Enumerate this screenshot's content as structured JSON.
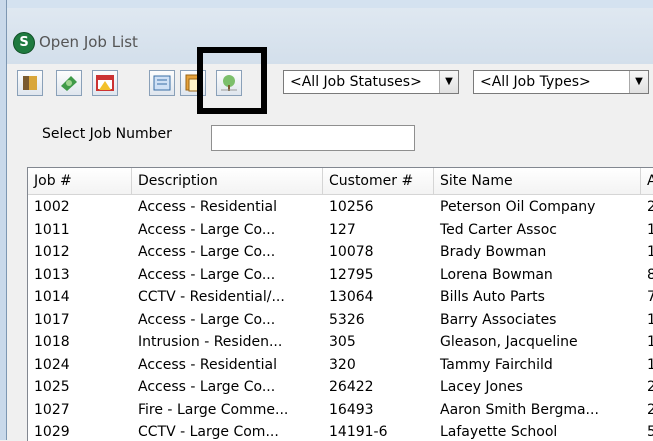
{
  "window": {
    "title": "Open Job List",
    "app_icon": "S"
  },
  "toolbar": {
    "buttons": [
      "book-icon",
      "money-icon",
      "calendar-alert-icon",
      "report-icon",
      "document-icon",
      "tree-icon"
    ],
    "status_filter": "<All Job Statuses>",
    "type_filter": "<All Job Types>"
  },
  "select_job": {
    "label": "Select Job Number",
    "value": ""
  },
  "grid": {
    "columns": [
      "Job #",
      "Description",
      "Customer #",
      "Site Name",
      "A"
    ],
    "rows": [
      [
        "1002",
        "Access - Residential",
        "10256",
        "Peterson Oil Company",
        "2"
      ],
      [
        "1011",
        "Access - Large Co...",
        "127",
        "Ted Carter Assoc",
        "1"
      ],
      [
        "1012",
        "Access - Large Co...",
        "10078",
        "Brady Bowman",
        "1"
      ],
      [
        "1013",
        "Access - Large Co...",
        "12795",
        "Lorena Bowman",
        "8"
      ],
      [
        "1014",
        "CCTV - Residential/...",
        "13064",
        "Bills Auto Parts",
        "7"
      ],
      [
        "1017",
        "Access - Large Co...",
        "5326",
        "Barry Associates",
        "1"
      ],
      [
        "1018",
        "Intrusion - Residen...",
        "305",
        "Gleason, Jacqueline",
        "1"
      ],
      [
        "1024",
        "Access - Residential",
        "320",
        "Tammy Fairchild",
        "1"
      ],
      [
        "1025",
        "Access - Large Co...",
        "26422",
        "Lacey Jones",
        "2"
      ],
      [
        "1027",
        "Fire - Large Comme...",
        "16493",
        "Aaron  Smith Bergma...",
        "2"
      ],
      [
        "1029",
        "CCTV - Large Com...",
        "14191-6",
        "Lafayette School",
        "5"
      ]
    ]
  }
}
